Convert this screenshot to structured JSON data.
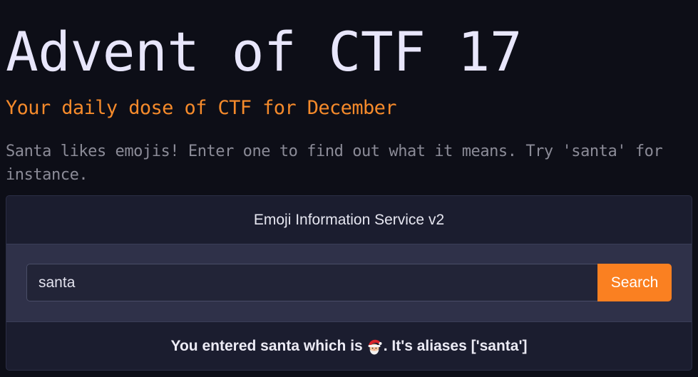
{
  "header": {
    "title": "Advent of CTF 17",
    "subtitle": "Your daily dose of CTF for December",
    "intro": "Santa likes emojis! Enter one to find out what it means. Try 'santa' for instance."
  },
  "card": {
    "header_title": "Emoji Information Service v2",
    "search": {
      "value": "santa",
      "placeholder": "",
      "button_label": "Search"
    },
    "result": {
      "prefix": "You entered santa which is",
      "emoji_icon": "santa-emoji-icon",
      "suffix": ". It's aliases ['santa']"
    }
  },
  "colors": {
    "background": "#0d0e17",
    "title": "#e8e6fb",
    "subtitle": "#f58a2b",
    "intro": "#8b8b97",
    "card_header": "#1b1d2f",
    "card_body": "#2f3149",
    "button": "#fa8021"
  }
}
